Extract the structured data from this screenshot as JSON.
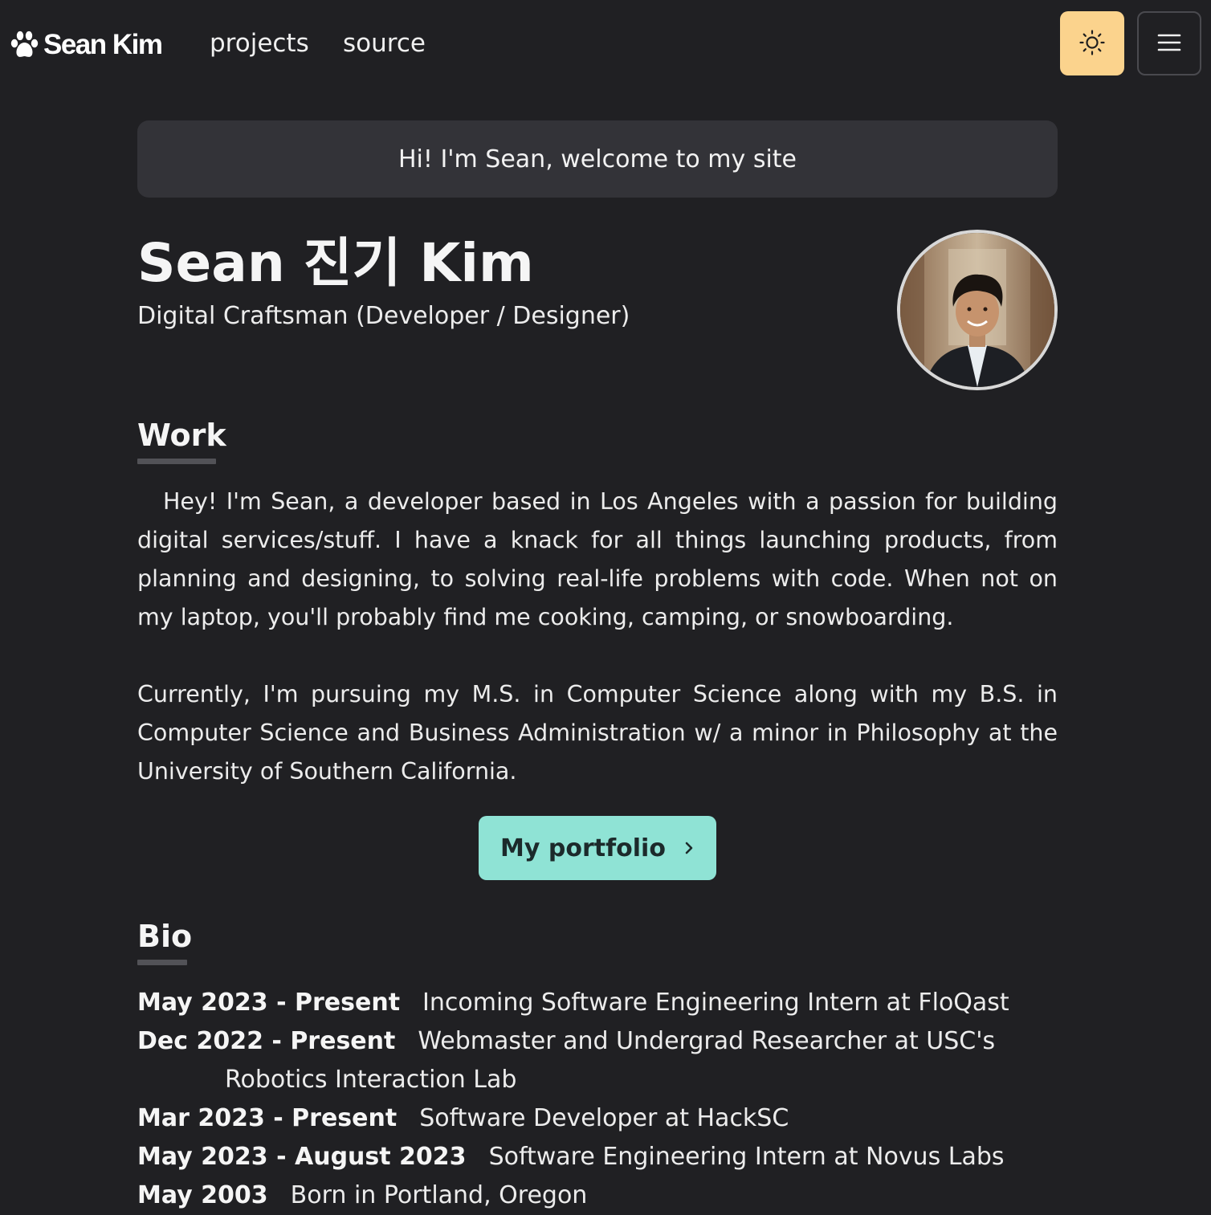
{
  "nav": {
    "logo_text": "Sean Kim",
    "links": [
      {
        "label": "projects"
      },
      {
        "label": "source"
      }
    ],
    "theme_toggle_icon": "sun-icon",
    "menu_icon": "hamburger-menu-icon"
  },
  "banner": {
    "text": "Hi! I'm Sean, welcome to my site"
  },
  "profile": {
    "name": "Sean 진기 Kim",
    "subtitle": "Digital Craftsman (Developer / Designer)"
  },
  "work": {
    "title": "Work",
    "paragraph_1": "Hey! I'm Sean, a developer based in Los Angeles with a passion for building digital services/stuff. I have a knack for all things launching products, from planning and designing, to solving real-life problems with code. When not on my laptop, you'll probably find me cooking, camping, or snowboarding.",
    "paragraph_2": "Currently, I'm pursuing my M.S. in Computer Science along with my B.S. in Computer Science and Business Administration w/ a minor in Philosophy at the University of Southern California.",
    "portfolio_button": "My portfolio"
  },
  "bio": {
    "title": "Bio",
    "entries": [
      {
        "year": "May 2023 - Present",
        "text": "Incoming Software Engineering Intern at FloQast"
      },
      {
        "year": "Dec 2022 - Present",
        "text": "Webmaster and Undergrad Researcher at USC's Robotics Interaction Lab"
      },
      {
        "year": "Mar 2023 - Present",
        "text": "Software Developer at HackSC"
      },
      {
        "year": "May 2023 - August 2023",
        "text": "Software Engineering Intern at Novus Labs"
      },
      {
        "year": "May 2003",
        "text": "Born in Portland, Oregon"
      }
    ]
  },
  "colors": {
    "background": "#202023",
    "banner": "#333338",
    "theme_button": "#fbd38d",
    "portfolio_button": "#8fe3d5"
  }
}
